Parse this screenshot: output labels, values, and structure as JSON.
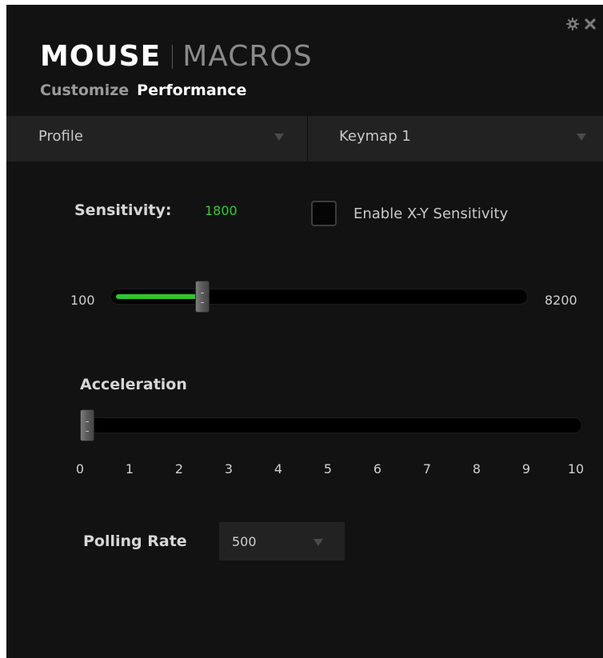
{
  "header": {
    "title_main": "MOUSE",
    "title_secondary": "MACROS",
    "tabs": [
      {
        "label": "Customize",
        "active": false
      },
      {
        "label": "Performance",
        "active": true
      }
    ],
    "icons": [
      "gear-icon",
      "close-icon"
    ]
  },
  "dropdowns": {
    "profile": {
      "label": "Profile"
    },
    "keymap": {
      "label": "Keymap 1"
    }
  },
  "sensitivity": {
    "label": "Sensitivity:",
    "value": "1800",
    "min": "100",
    "max": "8200",
    "xy_checkbox_label": "Enable X-Y Sensitivity",
    "xy_enabled": false
  },
  "acceleration": {
    "label": "Acceleration",
    "value": 0,
    "ticks": [
      "0",
      "1",
      "2",
      "3",
      "4",
      "5",
      "6",
      "7",
      "8",
      "9",
      "10"
    ]
  },
  "polling": {
    "label": "Polling Rate",
    "value": "500"
  },
  "colors": {
    "accent": "#2fc62f",
    "background": "#121212",
    "panel": "#222222"
  }
}
